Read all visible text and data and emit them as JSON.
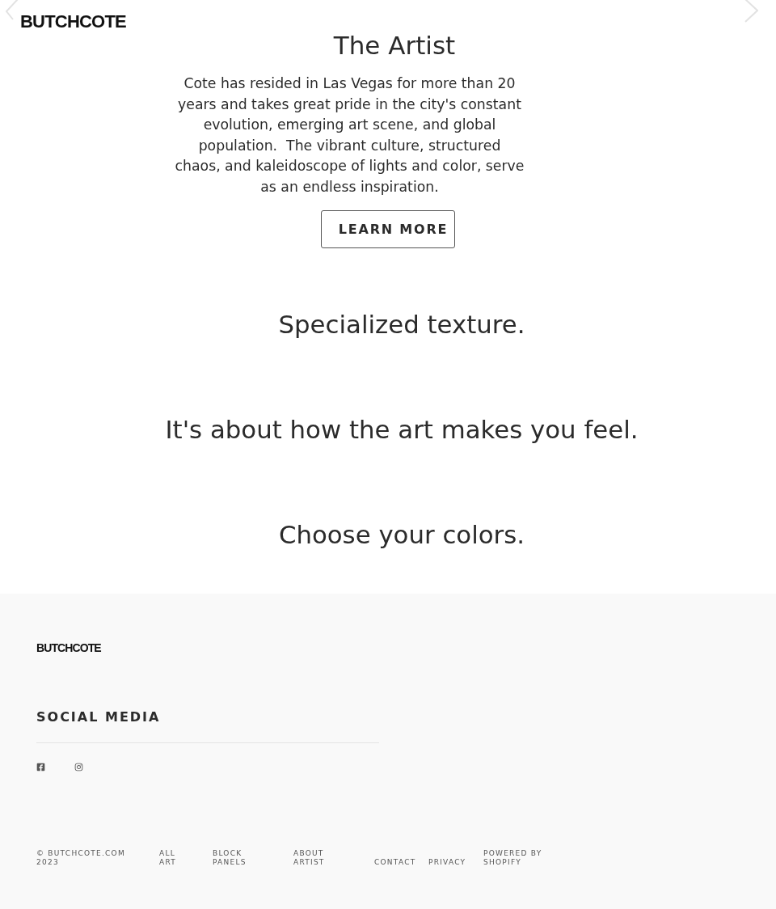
{
  "header": {
    "logo": "BUTCHCOTE"
  },
  "artist_section": {
    "title": "The Artist",
    "body": "Cote has resided in Las Vegas for more than 20 years and takes great pride in the city's constant evolution, emerging art scene, and global population.  The vibrant culture, structured chaos, and kaleidoscope of lights and color, serve as an endless inspiration.",
    "button": "LEARN MORE"
  },
  "taglines": [
    "Specialized texture.",
    "It's about how the art makes you feel.",
    "Choose your colors."
  ],
  "footer": {
    "logo": "BUTCHCOTE",
    "social_heading": "SOCIAL MEDIA",
    "social_links": [
      {
        "kind": "facebook"
      },
      {
        "kind": "instagram"
      }
    ],
    "copyright": "© BUTCHCOTE.COM 2023",
    "links": [
      "ALL ART",
      "BLOCK PANELS",
      "ABOUT ARTIST",
      "CONTACT",
      "PRIVACY",
      "POWERED BY SHOPIFY"
    ]
  }
}
